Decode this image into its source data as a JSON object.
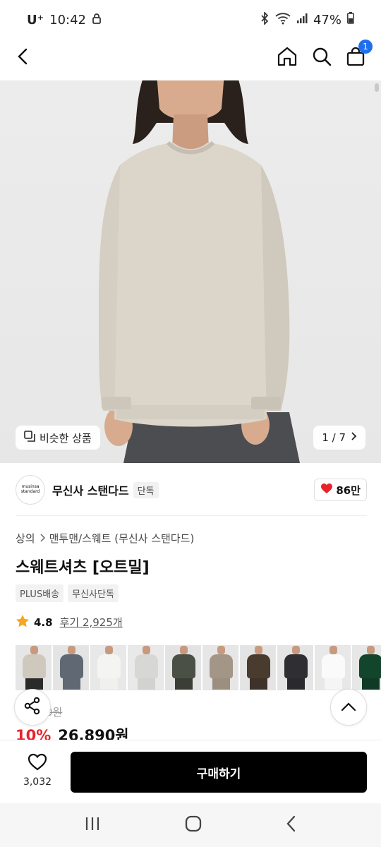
{
  "status": {
    "carrier": "U⁺",
    "time": "10:42",
    "battery": "47%"
  },
  "nav": {
    "cart_count": "1"
  },
  "hero": {
    "similar_label": "비슷한 상품",
    "counter": "1 / 7"
  },
  "brand": {
    "logo_line1": "musinsa",
    "logo_line2": "standard",
    "name": "무신사 스탠다드",
    "tag": "단독",
    "likes": "86만"
  },
  "breadcrumb": {
    "category": "상의",
    "subcategory": "맨투맨/스웨트 (무신사 스탠다드)"
  },
  "product": {
    "title": "스웨트셔츠 [오트밀]",
    "tags": [
      "PLUS배송",
      "무신사단독"
    ],
    "rating": "4.8",
    "review_link": "후기 2,925개",
    "original_price": "29,900원",
    "discount": "10%",
    "price": "26,890원"
  },
  "thumbnails": [
    {
      "shirt": "#cfc8bd",
      "pants": "#2a2a2a",
      "bg": "#e6e6e6"
    },
    {
      "shirt": "#5f6873",
      "pants": "#5f6873",
      "bg": "#e4e4e4"
    },
    {
      "shirt": "#f4f4f2",
      "pants": "#f0f0ee",
      "bg": "#e8e8e8"
    },
    {
      "shirt": "#d7d7d5",
      "pants": "#d2d2d0",
      "bg": "#e9e9e9"
    },
    {
      "shirt": "#4a5045",
      "pants": "#3a3e37",
      "bg": "#e3e3e3"
    },
    {
      "shirt": "#a39686",
      "pants": "#9c8f80",
      "bg": "#e6e6e6"
    },
    {
      "shirt": "#4a3b2f",
      "pants": "#3e3229",
      "bg": "#e4e4e4"
    },
    {
      "shirt": "#2f2f33",
      "pants": "#2a2a2e",
      "bg": "#e5e5e5"
    },
    {
      "shirt": "#fafafa",
      "pants": "#f5f5f5",
      "bg": "#e8e8e8"
    },
    {
      "shirt": "#12452c",
      "pants": "#0f3b26",
      "bg": "#e7e7e7"
    }
  ],
  "buybar": {
    "wish_count": "3,032",
    "buy_label": "구매하기"
  },
  "colors": {
    "accent": "#1f6feb",
    "discount": "#e8232a",
    "heart": "#e8232a",
    "star": "#f5a623"
  }
}
